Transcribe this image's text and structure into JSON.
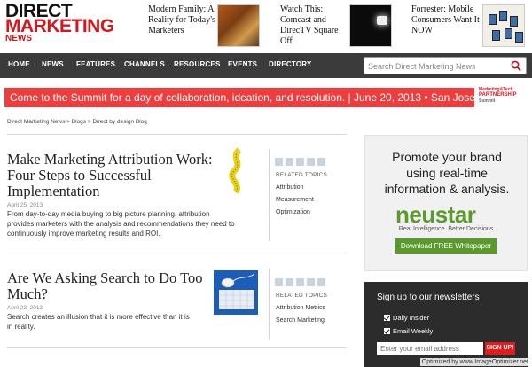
{
  "logo": {
    "line1": "DIRECT",
    "line2": "MARKETING",
    "line3": "NEWS"
  },
  "promos": [
    {
      "text": "Modern Family: A Reality for Today's Marketers"
    },
    {
      "text": "Watch This: Comcast and DirecTV Square Off"
    },
    {
      "text": "Forrester: Mobile Consumers Want It NOW"
    }
  ],
  "nav": {
    "items": [
      "HOME",
      "NEWS",
      "FEATURES",
      "CHANNELS",
      "RESOURCES",
      "EVENTS",
      "DIRECTORY"
    ],
    "search_placeholder": "Search Direct Marketing News"
  },
  "banner": {
    "text": "Come to the Summit for a day of collaboration, ideation, and resolution.  |  June 20, 2013 • San Jose",
    "logo_line1": "Marketing&Tech",
    "logo_line2": "PARTNERSHIP",
    "logo_line3": "Summit"
  },
  "breadcrumb": "Direct Marketing News  >  Blogs  >  Direct by design Blog",
  "articles": [
    {
      "title_line1": "Make Marketing Attribution Work:",
      "title_line2": "Four Steps to Successful",
      "title_line3": "Implementation",
      "date": "April 25, 2013",
      "desc_line1": "From day-to-day media buying to big picture planning, attribution",
      "desc_line2": "provides marketers with the analysis and recommendations they need to",
      "desc_line3": "continuously improve marketing results and ROI.",
      "related_heading": "RELATED TOPICS",
      "related": [
        "Attribution",
        "Measurement",
        "Optimization"
      ]
    },
    {
      "title_line1": "Are We Asking Search to Do Too",
      "title_line2": "Much?",
      "date": "April 23, 2013",
      "desc_line1": "Search creates an illusion that it is more effective than it is",
      "desc_line2": "in reality.",
      "related_heading": "RELATED TOPICS",
      "related": [
        "Attribution Metrics",
        "Search Marketing"
      ]
    }
  ],
  "ad": {
    "line1": "Promote your brand",
    "line2": "using real-time",
    "line3": "information & analysis.",
    "brand": "neustar",
    "tagline": "Real Intelligence. Better Decisions.",
    "button": "Download FREE Whitepaper"
  },
  "newsletter": {
    "title": "Sign up to our newsletters",
    "options": [
      "Daily Insider",
      "Email Weekly"
    ],
    "email_placeholder": "Enter your email address",
    "button": "SIGN UP!"
  },
  "watermark": "Optimized by www.ImageOptimizer.net",
  "colors": {
    "brand_red": "#d4181f",
    "nav_bg": "#3b3b3b",
    "banner_bg": "#ef3d3d",
    "ad_green": "#5a9a2a",
    "newsletter_bg": "#2c2c2c"
  }
}
